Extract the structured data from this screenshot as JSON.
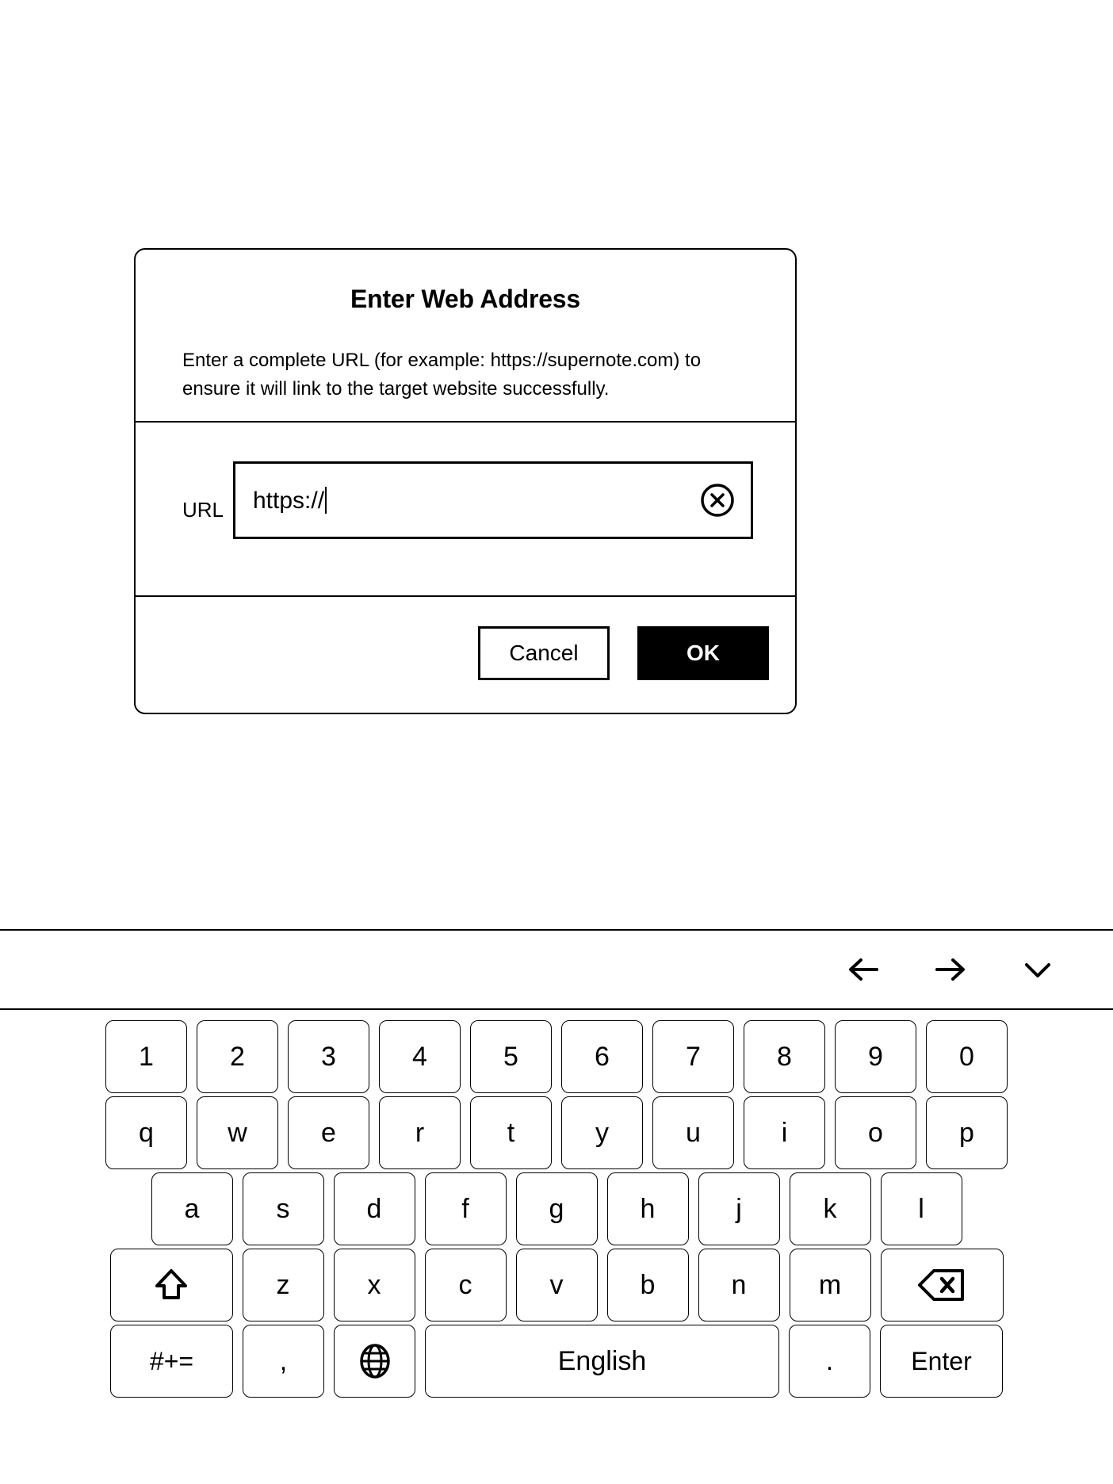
{
  "dialog": {
    "title": "Enter Web Address",
    "description": "Enter a complete URL (for example: https://supernote.com) to ensure it will link to the target website successfully.",
    "url_label": "URL",
    "url_value": "https://",
    "url_placeholder": "",
    "clear_icon": "circle-x-icon",
    "cancel_label": "Cancel",
    "ok_label": "OK"
  },
  "keyboard": {
    "toolbar": [
      {
        "name": "arrow-left-icon"
      },
      {
        "name": "arrow-right-icon"
      },
      {
        "name": "chevron-down-icon"
      }
    ],
    "rows": [
      {
        "name": "number-row",
        "keys": [
          {
            "label": "1",
            "w": "w-num"
          },
          {
            "label": "2",
            "w": "w-num"
          },
          {
            "label": "3",
            "w": "w-num"
          },
          {
            "label": "4",
            "w": "w-num"
          },
          {
            "label": "5",
            "w": "w-num"
          },
          {
            "label": "6",
            "w": "w-num"
          },
          {
            "label": "7",
            "w": "w-num"
          },
          {
            "label": "8",
            "w": "w-num"
          },
          {
            "label": "9",
            "w": "w-num"
          },
          {
            "label": "0",
            "w": "w-num"
          }
        ]
      },
      {
        "name": "top-letter-row",
        "keys": [
          {
            "label": "q",
            "w": "w-ltr"
          },
          {
            "label": "w",
            "w": "w-ltr"
          },
          {
            "label": "e",
            "w": "w-ltr"
          },
          {
            "label": "r",
            "w": "w-ltr"
          },
          {
            "label": "t",
            "w": "w-ltr"
          },
          {
            "label": "y",
            "w": "w-ltr"
          },
          {
            "label": "u",
            "w": "w-ltr"
          },
          {
            "label": "i",
            "w": "w-ltr"
          },
          {
            "label": "o",
            "w": "w-ltr"
          },
          {
            "label": "p",
            "w": "w-ltr"
          }
        ]
      },
      {
        "name": "home-letter-row",
        "keys": [
          {
            "label": "a",
            "w": "w-home"
          },
          {
            "label": "s",
            "w": "w-home"
          },
          {
            "label": "d",
            "w": "w-home"
          },
          {
            "label": "f",
            "w": "w-home"
          },
          {
            "label": "g",
            "w": "w-home"
          },
          {
            "label": "h",
            "w": "w-home"
          },
          {
            "label": "j",
            "w": "w-home"
          },
          {
            "label": "k",
            "w": "w-home"
          },
          {
            "label": "l",
            "w": "w-home"
          }
        ]
      },
      {
        "name": "bottom-letter-row",
        "keys": [
          {
            "label": "",
            "w": "w-shift",
            "icon": "shift-icon"
          },
          {
            "label": "z",
            "w": "w-ltr"
          },
          {
            "label": "x",
            "w": "w-ltr"
          },
          {
            "label": "c",
            "w": "w-ltr"
          },
          {
            "label": "v",
            "w": "w-ltr"
          },
          {
            "label": "b",
            "w": "w-ltr"
          },
          {
            "label": "n",
            "w": "w-ltr"
          },
          {
            "label": "m",
            "w": "w-ltr"
          },
          {
            "label": "",
            "w": "w-back",
            "icon": "backspace-icon"
          }
        ]
      },
      {
        "name": "function-row",
        "keys": [
          {
            "label": "#+=",
            "w": "w-sym",
            "cls": "sym-lbl"
          },
          {
            "label": ",",
            "w": "w-comma"
          },
          {
            "label": "",
            "w": "w-globe",
            "icon": "globe-icon"
          },
          {
            "label": "English",
            "w": "w-space",
            "cls": "lang-lbl"
          },
          {
            "label": ".",
            "w": "w-dot"
          },
          {
            "label": "Enter",
            "w": "w-enter",
            "cls": "enter-lbl"
          }
        ]
      }
    ]
  }
}
